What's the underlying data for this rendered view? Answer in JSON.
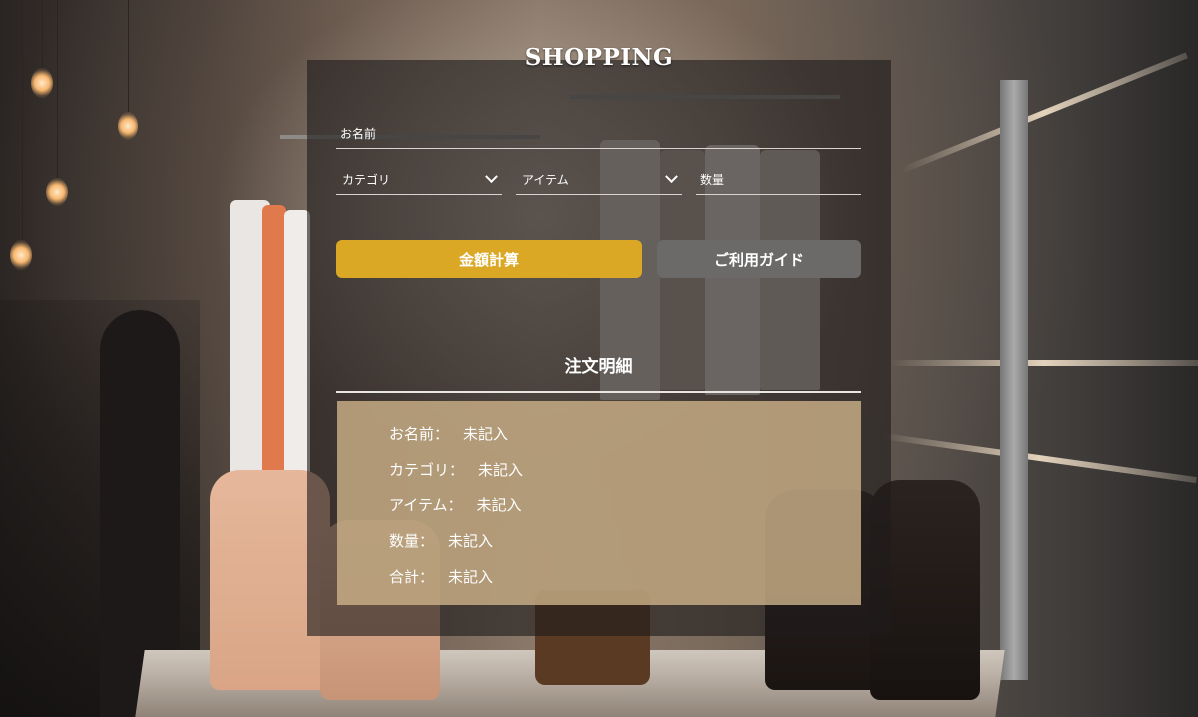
{
  "app": {
    "title": "SHOPPING"
  },
  "form": {
    "name_placeholder": "お名前",
    "name_value": "",
    "category_select": "カテゴリ",
    "item_select": "アイテム",
    "quantity_placeholder": "数量",
    "quantity_value": ""
  },
  "buttons": {
    "calculate_label": "金額計算",
    "guide_label": "ご利用ガイド"
  },
  "order_details": {
    "title": "注文明細",
    "rows": [
      {
        "label": "お名前：",
        "value": "未記入"
      },
      {
        "label": "カテゴリ：",
        "value": "未記入"
      },
      {
        "label": "アイテム：",
        "value": "未記入"
      },
      {
        "label": "数量：",
        "value": "未記入"
      },
      {
        "label": "合計：",
        "value": "未記入"
      }
    ]
  },
  "colors": {
    "accent": "#dba825",
    "secondary_button": "#6b6a69",
    "detail_box": "#cbb087"
  },
  "icons": {
    "select_arrow": "chevron-down-icon"
  }
}
